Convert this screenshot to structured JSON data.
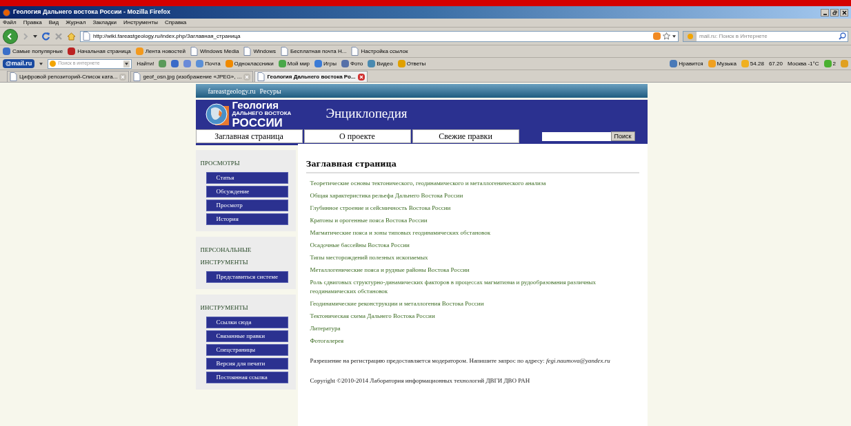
{
  "window": {
    "title": "Геология Дальнего востока России - Mozilla Firefox"
  },
  "menu": [
    "Файл",
    "Правка",
    "Вид",
    "Журнал",
    "Закладки",
    "Инструменты",
    "Справка"
  ],
  "address_bar": {
    "value": "http://wiki.fareastgeology.ru/index.php/Заглавная_страница"
  },
  "search_bar": {
    "placeholder": "mail.ru: Поиск в Интернете"
  },
  "bookmarks": [
    "Самые популярные",
    "Начальная страница",
    "Лента новостей",
    "Windows Media",
    "Windows",
    "Бесплатная почта Н...",
    "Настройка ссылок"
  ],
  "mail_toolbar": {
    "logo": "@mail.ru",
    "search_placeholder": "Поиск в интернете",
    "find_button": "Найти!",
    "items": [
      "Почта",
      "Одноклассники",
      "Мой мир",
      "Игры",
      "Фото",
      "Видео",
      "Ответы"
    ],
    "right_items": [
      "Нравится",
      "Музыка",
      "54.28",
      "67.20",
      "Москва -1°C",
      "2"
    ]
  },
  "tabs": [
    {
      "label": "Цифровой репозиторий-Список ката...",
      "selected": false
    },
    {
      "label": "geof_osn.jpg (изображение «JPEG», ...",
      "selected": false
    },
    {
      "label": "Геология Дальнего востока Ро...",
      "selected": true
    }
  ],
  "page": {
    "top_links": [
      "fareastgeology.ru",
      "Ресуры"
    ],
    "logo": [
      "Геология",
      "ДАЛЬНЕГО ВОСТОКА",
      "РОССИИ"
    ],
    "site_title": "Энциклопедия",
    "nav": [
      "Заглавная страница",
      "О проекте",
      "Свежие правки"
    ],
    "search_button": "Поиск",
    "sidebar": [
      {
        "title": "ПРОСМОТРЫ",
        "items": [
          "Статья",
          "Обсуждение",
          "Просмотр",
          "История"
        ]
      },
      {
        "title": "ПЕРСОНАЛЬНЫЕ ИНСТРУМЕНТЫ",
        "items": [
          "Представиться системе"
        ]
      },
      {
        "title": "ИНСТРУМЕНТЫ",
        "items": [
          "Ссылки сюда",
          "Связанные правки",
          "Спецстраницы",
          "Версия для печати",
          "Постоянная ссылка"
        ]
      }
    ],
    "heading": "Заглавная страница",
    "links": [
      "Теоретические основы тектонического, геодинамического и металлогенического анализа",
      "Общая характеристика рельефа Дальнего Востока России",
      "Глубинное строение и сейсмичность Востока России",
      "Кратоны и орогенные пояса Востока России",
      "Магматические пояса и зоны типовых геодинамических обстановок",
      "Осадочные бассейны Востока России",
      "Типы месторождений полезных ископаемых",
      "Металлогенические пояса и рудные районы Востока России",
      "Роль сдвиговых структурно-динамических факторов в процессах магматизма и рудообразования различных геодинамических обстановок",
      "Геодинамические реконструкции и металлогения Востока России",
      "Тектоническая схема Дальнего Востока России",
      "Литература",
      "Фотогалерея"
    ],
    "note": "Разрешение на регистрацию предоставляется модератором. Напишите запрос по адресу: *fegi.naumova@yandex.ru*",
    "copyright": "Copyright ©2010-2014 Лаборатория информационных технологий ДВГИ ДВО РАН"
  }
}
